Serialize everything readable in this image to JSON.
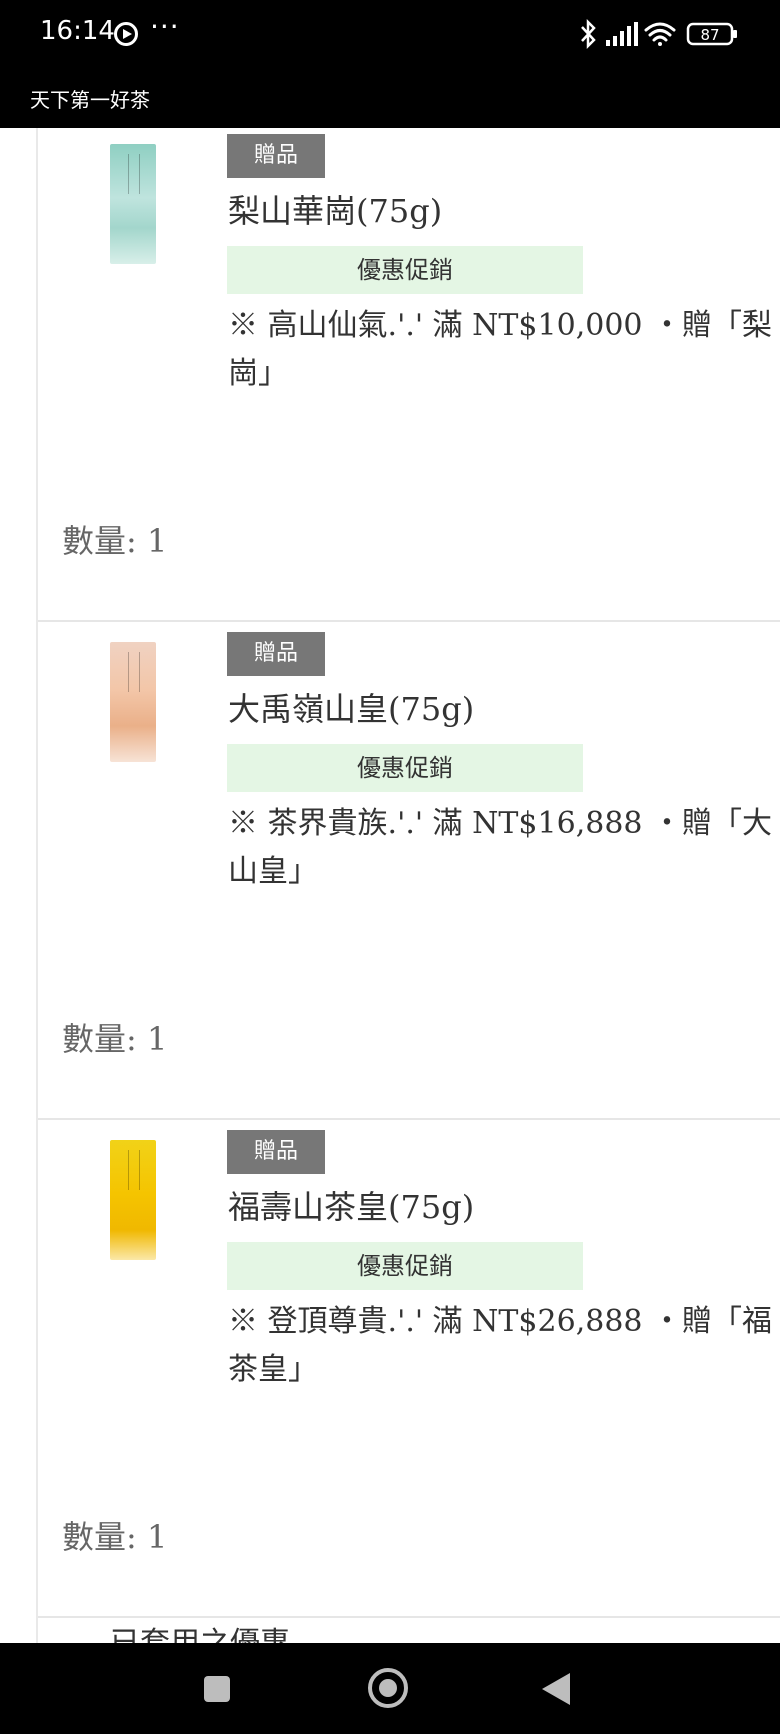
{
  "status_bar": {
    "time": "16:14",
    "more": "···",
    "battery": "87",
    "icons": [
      "media-icon",
      "bluetooth-icon",
      "signal-icon",
      "wifi-icon",
      "battery-icon"
    ]
  },
  "title_bar": {
    "title": "天下第一好茶"
  },
  "items": [
    {
      "badge": "贈品",
      "name": "梨山華崗(75g)",
      "promo_label": "優惠促銷",
      "promo_line1": "※ 高山仙氣.'.' 滿 NT$10,000 ・贈「梨",
      "promo_line2": "崗」",
      "qty": "數量: 1"
    },
    {
      "badge": "贈品",
      "name": "大禹嶺山皇(75g)",
      "promo_label": "優惠促銷",
      "promo_line1": "※ 茶界貴族.'.' 滿 NT$16,888 ・贈「大",
      "promo_line2": "山皇」",
      "qty": "數量: 1"
    },
    {
      "badge": "贈品",
      "name": "福壽山茶皇(75g)",
      "promo_label": "優惠促銷",
      "promo_line1": "※ 登頂尊貴.'.' 滿 NT$26,888 ・贈「福",
      "promo_line2": "茶皇」",
      "qty": "數量: 1"
    }
  ],
  "applied_discounts_heading": "已套用之優惠",
  "colors": {
    "badge_bg": "#777777",
    "promo_bg": "#e4f6e4",
    "bar_bg": "#000000"
  }
}
